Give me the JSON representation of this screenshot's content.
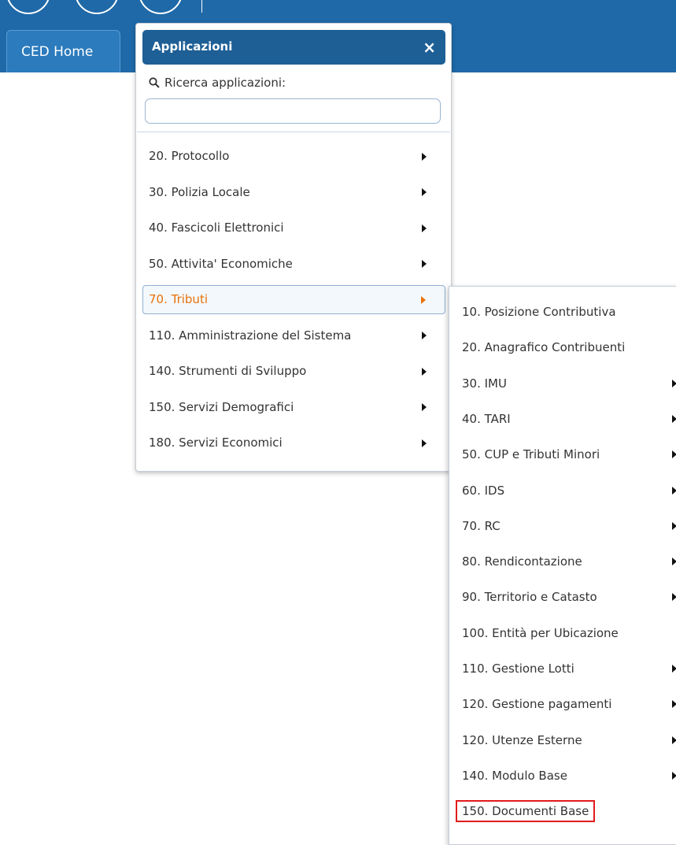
{
  "tab": {
    "label": "CED Home"
  },
  "apps": {
    "title": "Applicazioni",
    "close": "×",
    "search_label": "Ricerca applicazioni:",
    "search_value": "",
    "items": [
      {
        "label": "20. Protocollo",
        "has_submenu": true
      },
      {
        "label": "30. Polizia Locale",
        "has_submenu": true
      },
      {
        "label": "40. Fascicoli Elettronici",
        "has_submenu": true
      },
      {
        "label": "50. Attivita' Economiche",
        "has_submenu": true
      },
      {
        "label": "70. Tributi",
        "has_submenu": true,
        "active": true
      },
      {
        "label": "110. Amministrazione del Sistema",
        "has_submenu": true
      },
      {
        "label": "140. Strumenti di Sviluppo",
        "has_submenu": true
      },
      {
        "label": "150. Servizi Demografici",
        "has_submenu": true
      },
      {
        "label": "180. Servizi Economici",
        "has_submenu": true
      }
    ]
  },
  "submenu": {
    "items": [
      {
        "label": "10. Posizione Contributiva",
        "has_submenu": false
      },
      {
        "label": "20. Anagrafico Contribuenti",
        "has_submenu": false
      },
      {
        "label": "30. IMU",
        "has_submenu": true
      },
      {
        "label": "40. TARI",
        "has_submenu": true
      },
      {
        "label": "50. CUP e Tributi Minori",
        "has_submenu": true
      },
      {
        "label": "60. IDS",
        "has_submenu": true
      },
      {
        "label": "70. RC",
        "has_submenu": true
      },
      {
        "label": "80. Rendicontazione",
        "has_submenu": true
      },
      {
        "label": "90. Territorio e Catasto",
        "has_submenu": true
      },
      {
        "label": "100. Entità per Ubicazione",
        "has_submenu": false
      },
      {
        "label": "110. Gestione Lotti",
        "has_submenu": true
      },
      {
        "label": "120. Gestione pagamenti",
        "has_submenu": true
      },
      {
        "label": "120. Utenze Esterne",
        "has_submenu": true
      },
      {
        "label": "140. Modulo Base",
        "has_submenu": true
      },
      {
        "label": "150. Documenti Base",
        "has_submenu": false,
        "highlighted": true
      }
    ]
  },
  "colors": {
    "topbar": "#1f69a8",
    "header": "#1e5f96",
    "active_text": "#e8710a",
    "highlight_border": "#e01b1b"
  }
}
